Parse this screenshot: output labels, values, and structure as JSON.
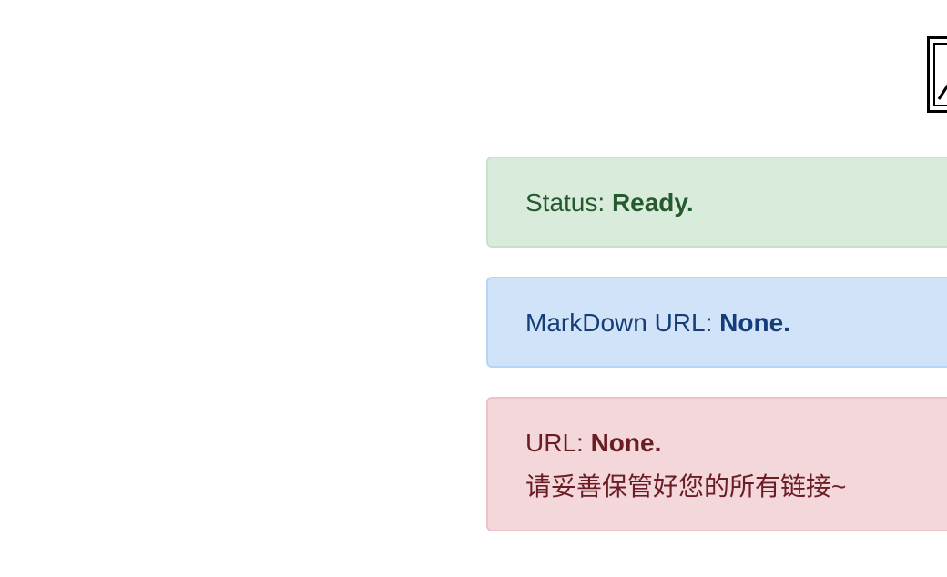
{
  "logo": {
    "icon": "broken-image-icon"
  },
  "status": {
    "label": "Status: ",
    "value": "Ready."
  },
  "markdown_url": {
    "label": "MarkDown URL: ",
    "value": "None."
  },
  "url": {
    "label": "URL: ",
    "value": "None.",
    "note": "请妥善保管好您的所有链接~"
  },
  "colors": {
    "success_bg": "#d9ecdc",
    "success_text": "#255a2e",
    "info_bg": "#d1e3f9",
    "info_text": "#153e78",
    "danger_bg": "#f3d7da",
    "danger_text": "#6b1d24"
  }
}
